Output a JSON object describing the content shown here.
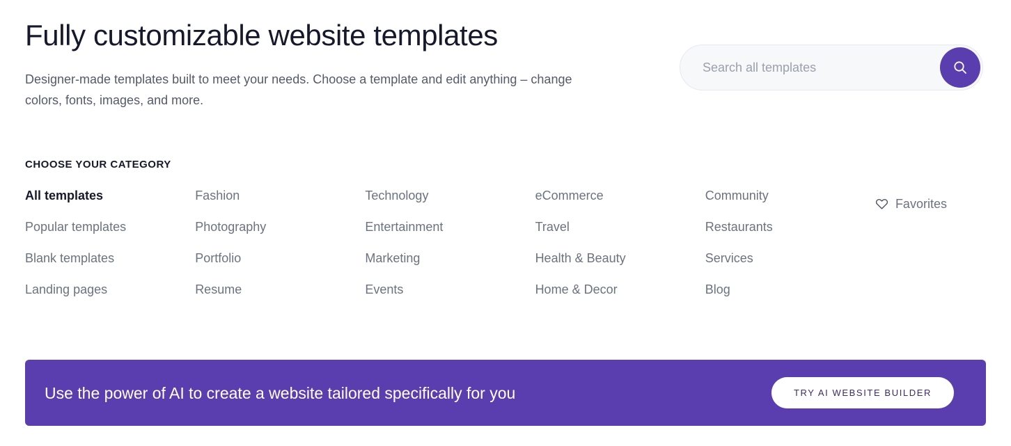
{
  "hero": {
    "title": "Fully customizable website templates",
    "subtitle": "Designer-made templates built to meet your needs. Choose a template and edit anything – change colors, fonts, images, and more."
  },
  "search": {
    "placeholder": "Search all templates",
    "value": "",
    "button_icon": "search-icon"
  },
  "categories": {
    "heading": "CHOOSE YOUR CATEGORY",
    "columns": [
      {
        "items": [
          {
            "label": "All templates",
            "active": true
          },
          {
            "label": "Popular templates",
            "active": false
          },
          {
            "label": "Blank templates",
            "active": false
          },
          {
            "label": "Landing pages",
            "active": false
          }
        ]
      },
      {
        "items": [
          {
            "label": "Fashion",
            "active": false
          },
          {
            "label": "Photography",
            "active": false
          },
          {
            "label": "Portfolio",
            "active": false
          },
          {
            "label": "Resume",
            "active": false
          }
        ]
      },
      {
        "items": [
          {
            "label": "Technology",
            "active": false
          },
          {
            "label": "Entertainment",
            "active": false
          },
          {
            "label": "Marketing",
            "active": false
          },
          {
            "label": "Events",
            "active": false
          }
        ]
      },
      {
        "items": [
          {
            "label": "eCommerce",
            "active": false
          },
          {
            "label": "Travel",
            "active": false
          },
          {
            "label": "Health & Beauty",
            "active": false
          },
          {
            "label": "Home & Decor",
            "active": false
          }
        ]
      },
      {
        "items": [
          {
            "label": "Community",
            "active": false
          },
          {
            "label": "Restaurants",
            "active": false
          },
          {
            "label": "Services",
            "active": false
          },
          {
            "label": "Blog",
            "active": false
          }
        ]
      }
    ],
    "favorites": {
      "label": "Favorites",
      "icon": "heart-outline-icon"
    }
  },
  "ai_banner": {
    "text": "Use the power of AI to create a website tailored specifically for you",
    "button_label": "TRY AI WEBSITE BUILDER",
    "background_color": "#5a3eb0",
    "button_text_color": "#3a2a70"
  },
  "colors": {
    "accent_purple": "#5a3eb0",
    "text_dark": "#16192c",
    "text_muted": "#6b7280",
    "search_bg": "#f7f8fa"
  }
}
